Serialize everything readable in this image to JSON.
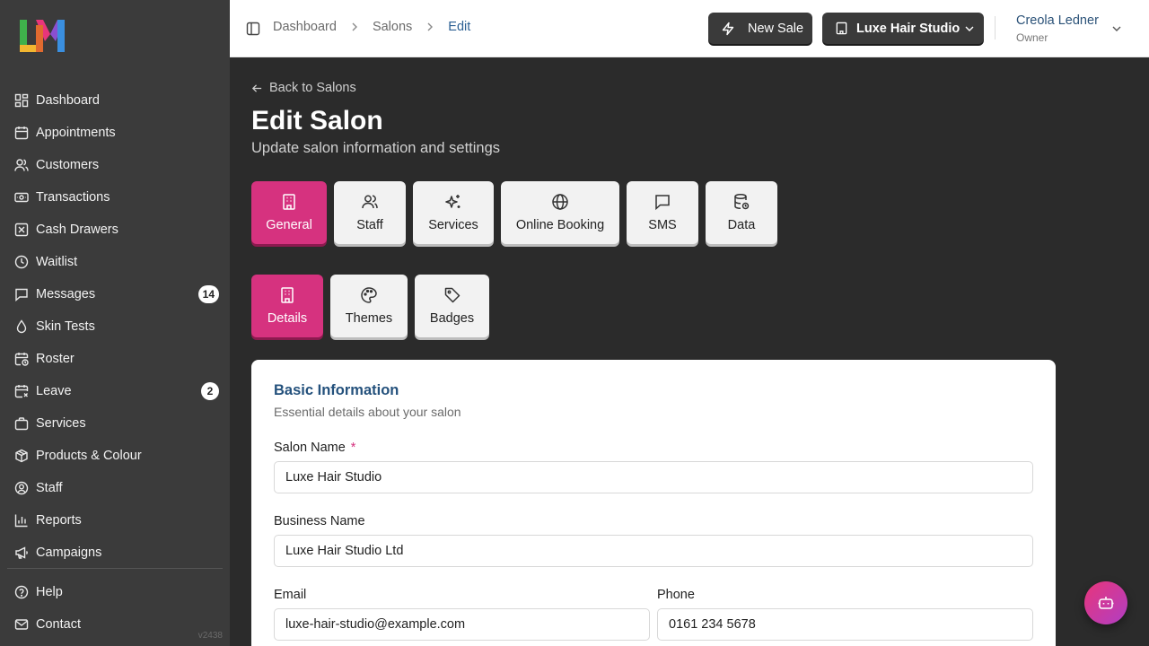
{
  "sidebar": {
    "items": [
      {
        "label": "Dashboard",
        "icon": "dashboard-icon"
      },
      {
        "label": "Appointments",
        "icon": "calendar-icon"
      },
      {
        "label": "Customers",
        "icon": "users-icon"
      },
      {
        "label": "Transactions",
        "icon": "banknote-icon"
      },
      {
        "label": "Cash Drawers",
        "icon": "cash-drawer-icon"
      },
      {
        "label": "Waitlist",
        "icon": "clock-icon"
      },
      {
        "label": "Messages",
        "icon": "message-icon",
        "badge": "14"
      },
      {
        "label": "Skin Tests",
        "icon": "droplet-icon"
      },
      {
        "label": "Roster",
        "icon": "calendar-clock-icon"
      },
      {
        "label": "Leave",
        "icon": "calendar-x-icon",
        "badge": "2"
      },
      {
        "label": "Services",
        "icon": "briefcase-icon"
      },
      {
        "label": "Products & Colour",
        "icon": "package-icon"
      },
      {
        "label": "Staff",
        "icon": "user-circle-icon"
      },
      {
        "label": "Reports",
        "icon": "bar-chart-icon"
      },
      {
        "label": "Campaigns",
        "icon": "megaphone-icon"
      }
    ],
    "bottom": [
      {
        "label": "Help",
        "icon": "help-icon"
      },
      {
        "label": "Contact",
        "icon": "mail-icon"
      }
    ],
    "version": "v2438"
  },
  "header": {
    "breadcrumb": [
      "Dashboard",
      "Salons",
      "Edit"
    ],
    "new_sale": "New Sale",
    "salon_selector": "Luxe Hair Studio",
    "user_name": "Creola Ledner",
    "user_role": "Owner"
  },
  "page": {
    "back": "Back to Salons",
    "title": "Edit Salon",
    "subtitle": "Update salon information and settings"
  },
  "tabs": [
    {
      "label": "General",
      "active": true
    },
    {
      "label": "Staff"
    },
    {
      "label": "Services"
    },
    {
      "label": "Online Booking"
    },
    {
      "label": "SMS"
    },
    {
      "label": "Data"
    }
  ],
  "subtabs": [
    {
      "label": "Details",
      "active": true
    },
    {
      "label": "Themes"
    },
    {
      "label": "Badges"
    }
  ],
  "card": {
    "title": "Basic Information",
    "description": "Essential details about your salon",
    "fields": {
      "salon_name": {
        "label": "Salon Name",
        "required": "*",
        "value": "Luxe Hair Studio"
      },
      "business_name": {
        "label": "Business Name",
        "value": "Luxe Hair Studio Ltd"
      },
      "email": {
        "label": "Email",
        "value": "luxe-hair-studio@example.com"
      },
      "phone": {
        "label": "Phone",
        "value": "0161 234 5678"
      }
    }
  },
  "colors": {
    "accent": "#d6327f",
    "sidebar": "#3b3b3b",
    "background": "#2b2b2b"
  }
}
